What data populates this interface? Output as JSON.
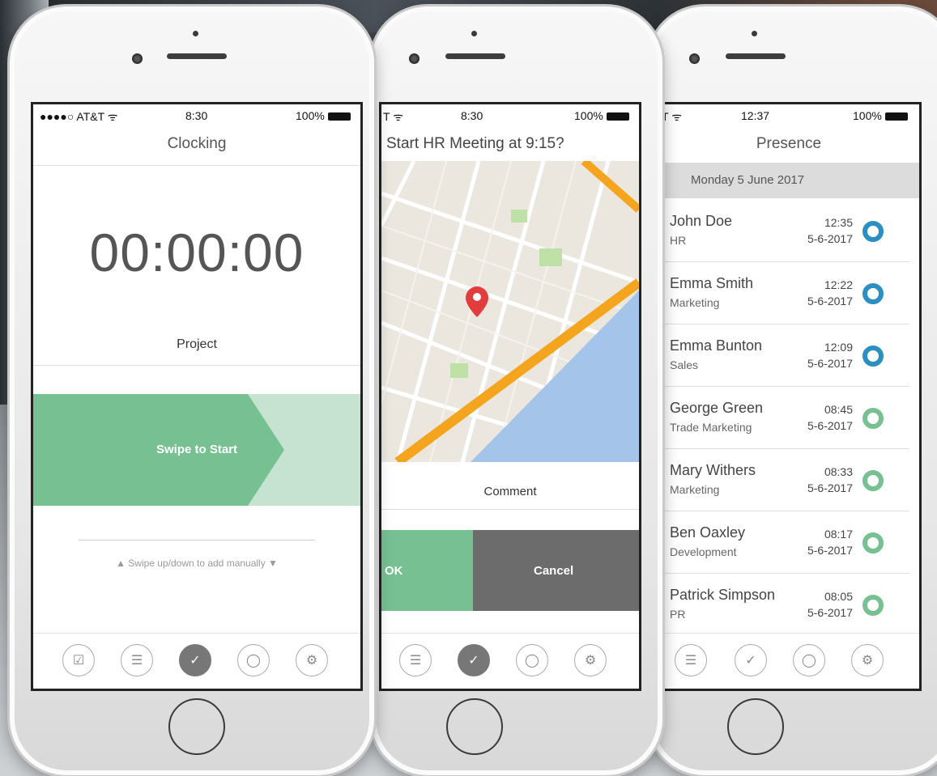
{
  "left_phone": {
    "status": {
      "carrier": "●●●●○ AT&T ᯤ",
      "time": "8:30",
      "battery": "100%"
    },
    "title": "Clocking",
    "timer": "00:00:00",
    "project_label": "Project",
    "swipe_label": "Swipe to Start",
    "manual_hint": "▲ Swipe up/down to add manually ▼"
  },
  "middle_phone": {
    "status": {
      "carrier": "T ᯤ",
      "time": "8:30",
      "battery": "100%"
    },
    "title": "Start HR Meeting at 9:15?",
    "comment_label": "Comment",
    "ok_label": "OK",
    "cancel_label": "Cancel"
  },
  "right_phone": {
    "status": {
      "carrier": "T ᯤ",
      "time": "12:37",
      "battery": "100%"
    },
    "title": "Presence",
    "date_header": "Monday 5 June 2017",
    "people": [
      {
        "name": "John Doe",
        "dept": "HR",
        "time": "12:35",
        "date": "5-6-2017",
        "color": "#2b8fc1"
      },
      {
        "name": "Emma Smith",
        "dept": "Marketing",
        "time": "12:22",
        "date": "5-6-2017",
        "color": "#2b8fc1"
      },
      {
        "name": "Emma Bunton",
        "dept": "Sales",
        "time": "12:09",
        "date": "5-6-2017",
        "color": "#2b8fc1"
      },
      {
        "name": "George Green",
        "dept": "Trade Marketing",
        "time": "08:45",
        "date": "5-6-2017",
        "color": "#76c092"
      },
      {
        "name": "Mary Withers",
        "dept": "Marketing",
        "time": "08:33",
        "date": "5-6-2017",
        "color": "#76c092"
      },
      {
        "name": "Ben Oaxley",
        "dept": "Development",
        "time": "08:17",
        "date": "5-6-2017",
        "color": "#76c092"
      },
      {
        "name": "Patrick Simpson",
        "dept": "PR",
        "time": "08:05",
        "date": "5-6-2017",
        "color": "#76c092"
      }
    ]
  },
  "icons": {
    "tasks": "☑",
    "list": "☰",
    "clock": "✓",
    "person": "◯",
    "settings": "⚙"
  }
}
